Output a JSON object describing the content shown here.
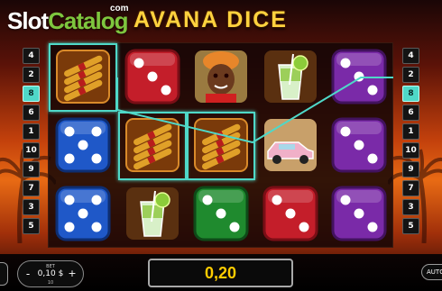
{
  "watermark": {
    "slot": "Slot",
    "catalog": "Catalog",
    "com": "com"
  },
  "game": {
    "title": "AVANA DICE"
  },
  "paylines": {
    "left": [
      "4",
      "2",
      "8",
      "6",
      "1",
      "10",
      "9",
      "7",
      "3",
      "5"
    ],
    "right": [
      "4",
      "2",
      "8",
      "6",
      "1",
      "10",
      "9",
      "7",
      "3",
      "5"
    ],
    "active": "8"
  },
  "reels": {
    "grid": [
      [
        "cigars",
        "dice-red-3",
        "lady",
        "cocktail",
        "dice-purple-3"
      ],
      [
        "dice-blue-5",
        "cigars",
        "cigars",
        "car",
        "dice-purple-3"
      ],
      [
        "dice-blue-5",
        "cocktail",
        "dice-green-3",
        "dice-red-3",
        "dice-purple-3"
      ]
    ],
    "highlighted": [
      [
        0,
        0
      ],
      [
        1,
        1
      ],
      [
        1,
        2
      ]
    ]
  },
  "controls": {
    "bet_label": "BET",
    "bet_value": "0,10 $",
    "bet_sub": "10",
    "minus": "-",
    "plus": "+",
    "win_value": "0,20",
    "auto_label": "AUTO"
  },
  "colors": {
    "highlight": "#4fd8c8",
    "win_text": "#ffcc00",
    "title": "#ffd23e",
    "watermark_green": "#7ec63e"
  }
}
